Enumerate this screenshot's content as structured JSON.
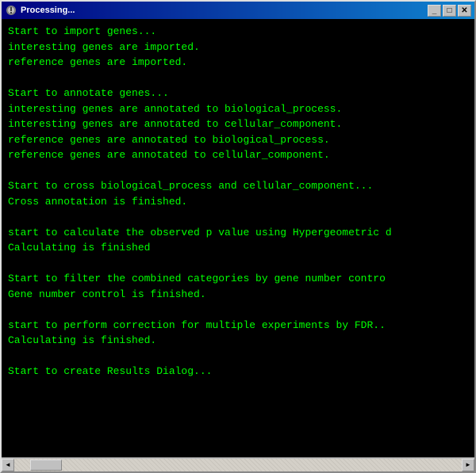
{
  "window": {
    "title": "Processing...",
    "icon": "gear-icon",
    "buttons": {
      "minimize": "_",
      "maximize": "□",
      "close": "✕"
    }
  },
  "console": {
    "lines": [
      "Start to import genes...",
      "interesting genes are imported.",
      "reference genes are imported.",
      "",
      "Start to annotate genes...",
      "interesting genes are annotated to biological_process.",
      "interesting genes are annotated to cellular_component.",
      "reference genes are annotated to biological_process.",
      "reference genes are annotated to cellular_component.",
      "",
      "Start to cross biological_process and cellular_component...",
      "Cross annotation is finished.",
      "",
      "start to calculate the observed p value using Hypergeometric d",
      "Calculating is finished",
      "",
      "Start to filter the combined categories by gene number contro",
      "Gene number control is finished.",
      "",
      "start to perform correction for multiple experiments by FDR..",
      "Calculating is finished.",
      "",
      "Start to create Results Dialog..."
    ]
  },
  "scrollbar": {
    "left_arrow": "◄",
    "right_arrow": "►"
  }
}
